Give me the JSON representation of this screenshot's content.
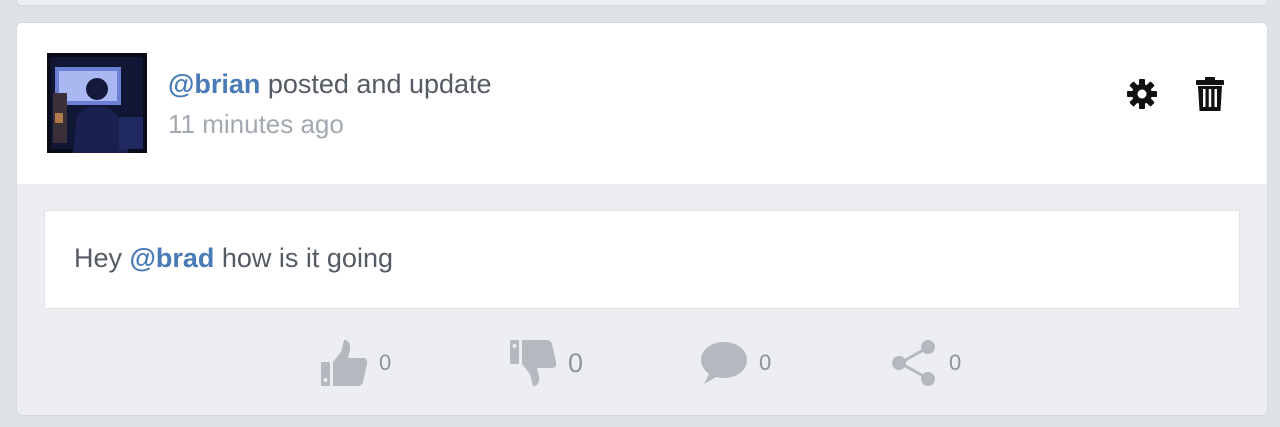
{
  "post": {
    "author": "@brian",
    "action_text": " posted and update",
    "time_ago": "11 minutes ago",
    "body": {
      "prefix": "Hey ",
      "mention": "@brad",
      "suffix": " how is it going"
    },
    "actions": {
      "settings_icon": "gear-icon",
      "delete_icon": "trash-icon"
    },
    "reactions": {
      "likes": "0",
      "dislikes": "0",
      "comments": "0",
      "shares": "0"
    }
  },
  "colors": {
    "mention": "#4a7bb7",
    "text": "#555b63",
    "muted": "#a3a9b0",
    "icon_muted": "#b4b9bf"
  }
}
